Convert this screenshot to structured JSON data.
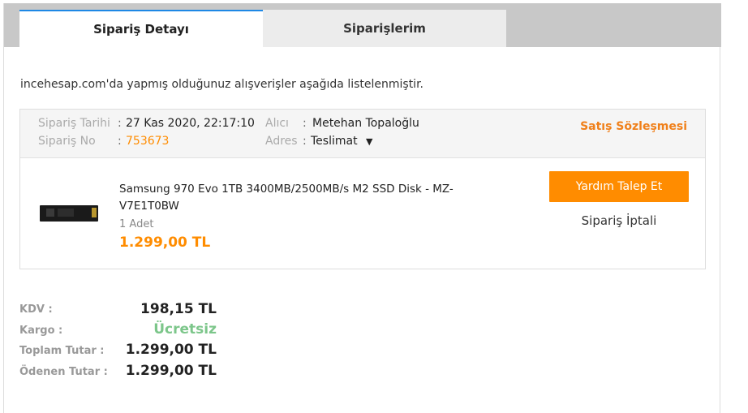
{
  "tabs": [
    {
      "label": "Sipariş Detayı",
      "active": true
    },
    {
      "label": "Siparişlerim",
      "active": false
    }
  ],
  "intro_text": "incehesap.com'da yapmış olduğunuz alışverişler aşağıda listelenmiştir.",
  "order": {
    "date_label": "Sipariş Tarihi",
    "date_value": "27 Kas 2020, 22:17:10",
    "no_label": "Sipariş No",
    "no_value": "753673",
    "recipient_label": "Alıcı",
    "recipient_value": "Metehan Topaloğlu",
    "address_label": "Adres",
    "address_value": "Teslimat",
    "contract_link": "Satış Sözleşmesi"
  },
  "product": {
    "name": "Samsung 970 Evo 1TB 3400MB/2500MB/s M2 SSD Disk - MZ-V7E1T0BW",
    "quantity": "1 Adet",
    "price": "1.299,00 TL",
    "help_button": "Yardım Talep Et",
    "cancel_link": "Sipariş İptali"
  },
  "summary": {
    "kdv_label": "KDV :",
    "kdv_value": "198,15 TL",
    "cargo_label": "Kargo :",
    "cargo_value": "Ücretsiz",
    "total_label": "Toplam Tutar :",
    "total_value": "1.299,00 TL",
    "paid_label": "Ödenen Tutar :",
    "paid_value": "1.299,00 TL"
  },
  "colors": {
    "accent": "#ff8c00",
    "tab_active_border": "#1e88e5",
    "free_green": "#7cc68a"
  }
}
